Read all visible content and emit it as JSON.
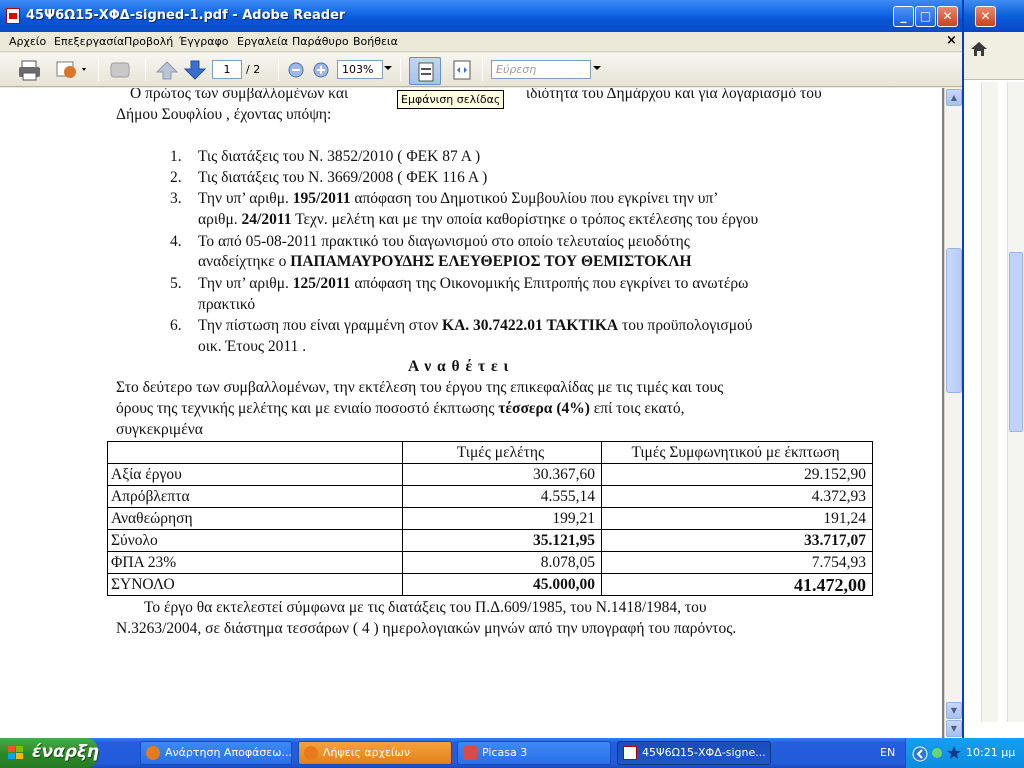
{
  "window": {
    "title": "45Ψ6Ω15-ΧΦΔ-signed-1.pdf - Adobe Reader",
    "caption_min": "_",
    "caption_max": "□",
    "caption_close": "✕"
  },
  "menu": {
    "items": [
      "Αρχείο",
      "Επεξεργασία",
      "Προβολή",
      "Έγγραφο",
      "Εργαλεία",
      "Παράθυρο",
      "Βοήθεια"
    ],
    "close_label": "×"
  },
  "toolbar": {
    "page_current": "1",
    "page_total": "/ 2",
    "zoom": "103%",
    "find_placeholder": "Εύρεση"
  },
  "tooltip": "Εμφάνιση σελίδας",
  "document": {
    "intro_line1": "Ο πρώτος των συμβαλλομένων και ",
    "intro_line1_end": " ιδιότητα του Δημάρχου και για λογαριασμό του",
    "intro_line2": "Δήμου Σουφλίου , έχοντας υπόψη:",
    "items": [
      {
        "num": "1.",
        "text": "Τις διατάξεις του Ν. 3852/2010 ( ΦΕΚ 87  Α )"
      },
      {
        "num": "2.",
        "text": "Τις διατάξεις του Ν. 3669/2008 ( ΦΕΚ 116  Α )"
      },
      {
        "num": "3.",
        "a": "Την υπ’  αριθμ. ",
        "b": "195/2011",
        "c": " απόφαση του Δημοτικού Συμβουλίου που εγκρίνει την υπ’",
        "d": "αριθμ. ",
        "e": "24/2011",
        "f": " Τεχν. μελέτη και με την οποία καθορίστηκε ο τρόπος εκτέλεσης του έργου"
      },
      {
        "num": "4.",
        "a": "Το  από  05-08-2011  πρακτικό  του  διαγωνισμού  στο  οποίο  τελευταίος  μειοδότης",
        "b": "αναδείχτηκε ο ",
        "c": "ΠΑΠΑΜΑΥΡΟΥΔΗΣ ΕΛΕΥΘΕΡΙΟΣ ΤΟΥ ΘΕΜΙΣΤΟΚΛΗ"
      },
      {
        "num": "5.",
        "a": " Την υπ’ αριθμ. ",
        "b": "125/2011",
        "c": " απόφαση της Οικονομικής  Επιτροπής που εγκρίνει το ανωτέρω",
        "d": "πρακτικό"
      },
      {
        "num": "6.",
        "a": "Την πίστωση που είναι γραμμένη στον ",
        "b": "ΚΑ. 30.7422.01 ΤΑΚΤΙΚΑ",
        "c": " του προϋπολογισμού",
        "d": "οικ. Έτους 2011 ."
      }
    ],
    "heading": "Α ν α θ έ τ ε ι",
    "para1_line1": "Στο δεύτερο των συμβαλλομένων, την εκτέλεση του έργου της επικεφαλίδας με τις τιμές και τους",
    "para1_line2a": "όρους της τεχνικής μελέτης και με ενιαίο ποσοστό έκπτωσης ",
    "para1_line2b": "τέσσερα  (4%)",
    "para1_line2c": "  επί τοις εκατό,",
    "para1_line3": "συγκεκριμένα",
    "table": {
      "headers": [
        "",
        "Τιμές μελέτης",
        "Τιμές Συμφωνητικού με έκπτωση"
      ],
      "rows": [
        [
          "Αξία έργου",
          "30.367,60",
          "29.152,90"
        ],
        [
          "Απρόβλεπτα",
          "4.555,14",
          "4.372,93"
        ],
        [
          "Αναθεώρηση",
          "199,21",
          "191,24"
        ],
        [
          "Σύνολο",
          "35.121,95",
          "33.717,07"
        ],
        [
          "ΦΠΑ 23%",
          "8.078,05",
          "7.754,93"
        ],
        [
          "ΣΥΝΟΛΟ",
          "45.000,00",
          "41.472,00"
        ]
      ]
    },
    "para2_line1": "Το έργο θα εκτελεστεί σύμφωνα με τις διατάξεις του Π.Δ.609/1985, του Ν.1418/1984, του",
    "para2_line2": "Ν.3263/2004, σε διάστημα  τεσσάρων ( 4 ) ημερολογιακών μηνών από την υπογραφή του παρόντος."
  },
  "taskbar": {
    "start_label": "έναρξη",
    "tasks": [
      "Ανάρτηση Αποφάσεω...",
      "Λήψεις αρχείων",
      "Picasa 3",
      "45Ψ6Ω15-ΧΦΔ-signe..."
    ],
    "lang": "EN",
    "clock": "10:21 μμ"
  },
  "colors": {
    "titlebar": "#0855d8",
    "taskbar": "#245edc",
    "start": "#2e8a2b"
  }
}
